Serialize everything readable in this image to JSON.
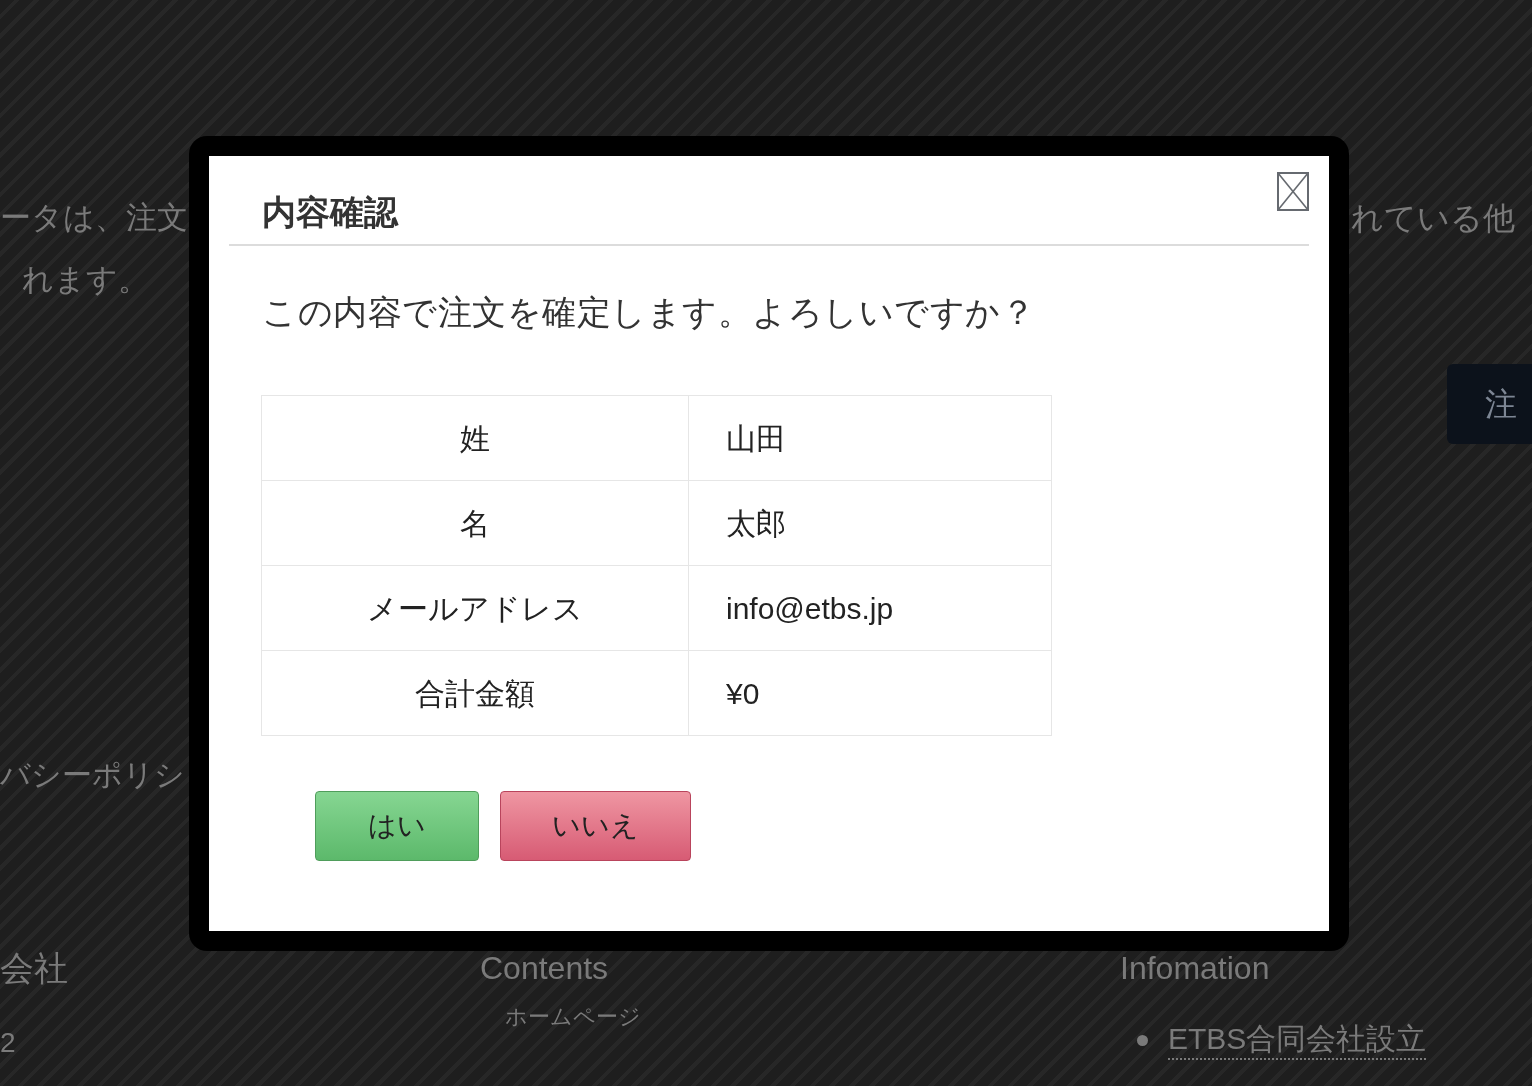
{
  "page": {
    "notice_left": [
      "ータは、注文",
      "れます。"
    ],
    "notice_right": "れている他",
    "order_button": "注",
    "privacy_link": "バシーポリシ",
    "footer": {
      "company": {
        "heading": "会社",
        "lines": [
          "2"
        ]
      },
      "contents": {
        "heading": "Contents",
        "links": [
          "ホームページ"
        ]
      },
      "information": {
        "heading": "Infomation",
        "items": [
          "ETBS合同会社設立"
        ]
      }
    }
  },
  "dialog": {
    "title": "内容確認",
    "message": "この内容で注文を確定します。よろしいですか？",
    "rows": [
      {
        "label": "姓",
        "value": "山田"
      },
      {
        "label": "名",
        "value": "太郎"
      },
      {
        "label": "メールアドレス",
        "value": "info@etbs.jp"
      },
      {
        "label": "合計金額",
        "value": "¥0"
      }
    ],
    "buttons": [
      {
        "label": "はい",
        "kind": "confirm"
      },
      {
        "label": "いいえ",
        "kind": "cancel"
      }
    ]
  }
}
